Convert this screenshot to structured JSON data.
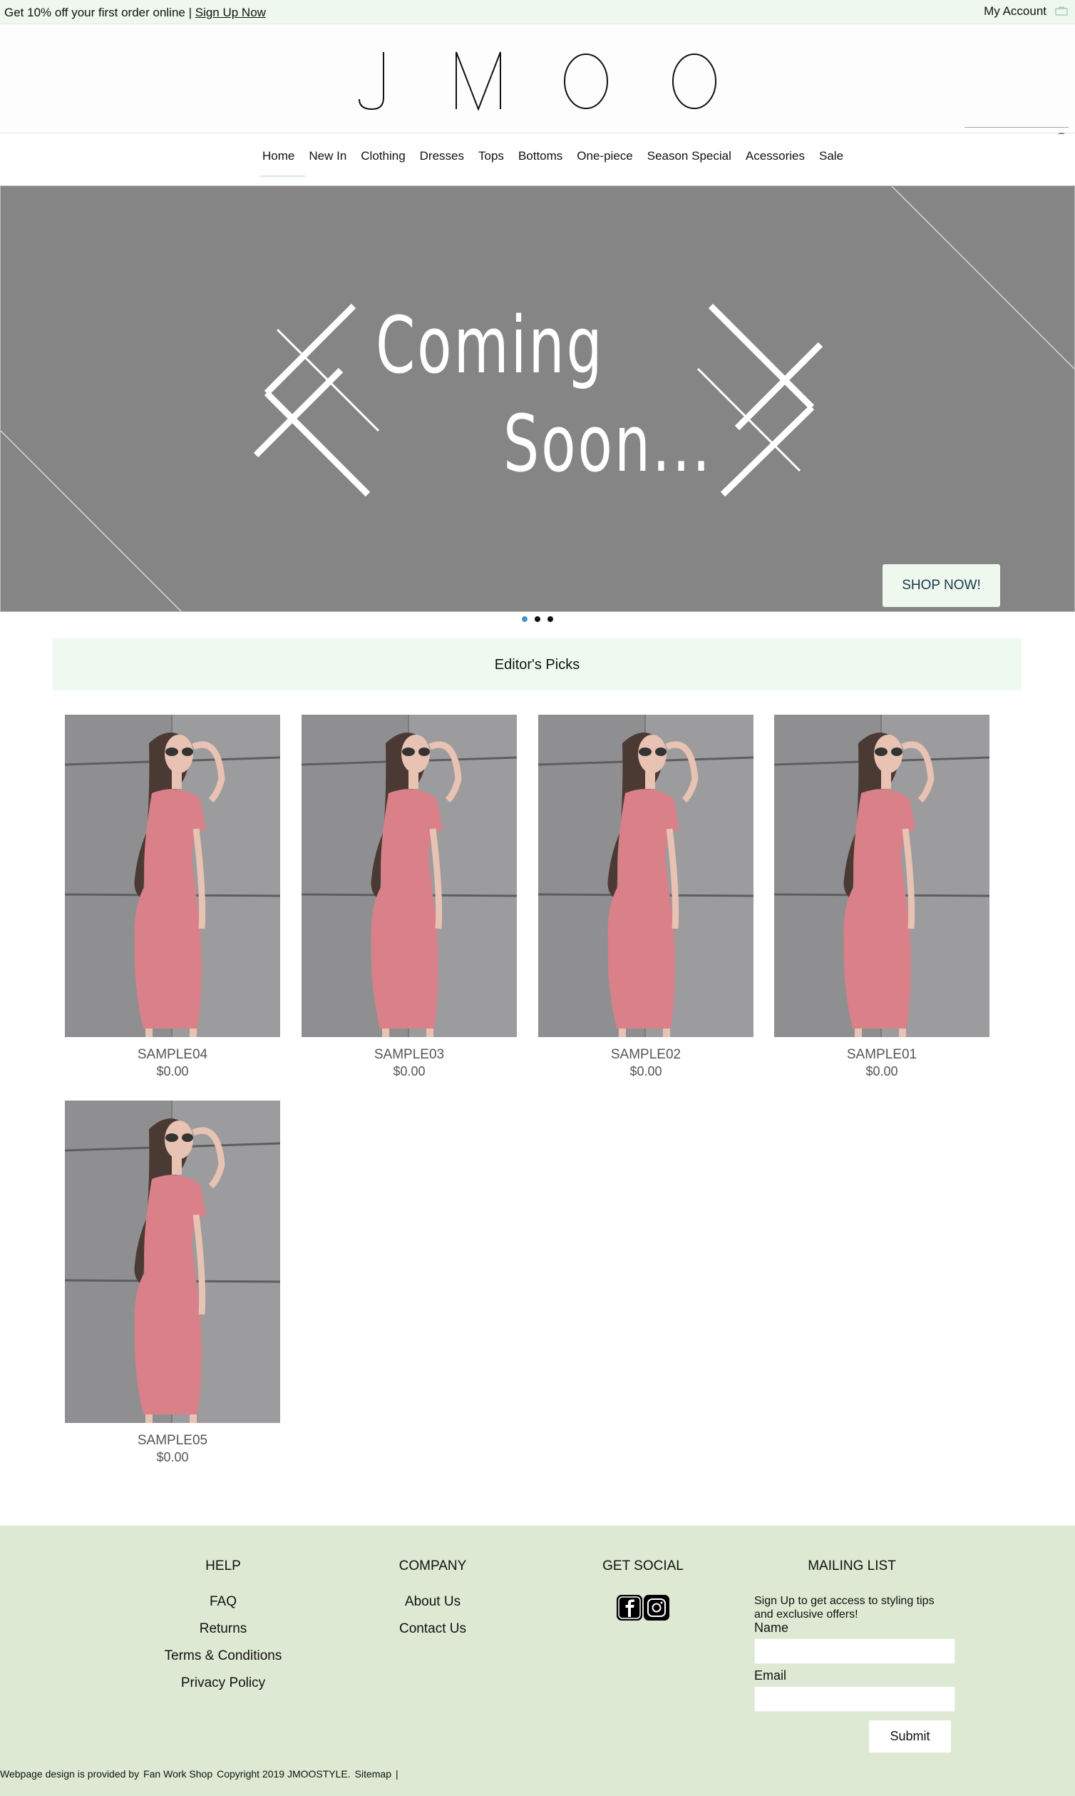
{
  "promo": {
    "text": "Get 10% off your first order online | ",
    "link": "Sign Up Now"
  },
  "header": {
    "account_label": "My Account",
    "logo_letters": [
      "J",
      "M",
      "O",
      "O"
    ],
    "search_placeholder": ""
  },
  "nav": {
    "items": [
      "Home",
      "New In",
      "Clothing",
      "Dresses",
      "Tops",
      "Bottoms",
      "One-piece",
      "Season Special",
      "Acessories",
      "Sale"
    ],
    "active": "Home"
  },
  "hero": {
    "line1": "Coming",
    "line2": "Soon...",
    "button": "SHOP NOW!",
    "slides": 3,
    "active_slide": 1
  },
  "picks": {
    "title": "Editor's Picks"
  },
  "products": [
    {
      "name": "SAMPLE04",
      "price": "$0.00"
    },
    {
      "name": "SAMPLE03",
      "price": "$0.00"
    },
    {
      "name": "SAMPLE02",
      "price": "$0.00"
    },
    {
      "name": "SAMPLE01",
      "price": "$0.00"
    },
    {
      "name": "SAMPLE05",
      "price": "$0.00"
    }
  ],
  "footer": {
    "help": {
      "title": "HELP",
      "links": [
        "FAQ",
        "Returns",
        "Terms & Conditions",
        "Privacy Policy"
      ]
    },
    "company": {
      "title": "COMPANY",
      "links": [
        "About Us",
        "Contact Us"
      ]
    },
    "social": {
      "title": "GET SOCIAL",
      "icons": [
        "facebook-icon",
        "instagram-icon"
      ]
    },
    "mailing": {
      "title": "MAILING LIST",
      "description": "Sign Up to get access to styling tips and exclusive offers!",
      "name_label": "Name",
      "email_label": "Email",
      "submit": "Submit"
    },
    "credits": [
      "Webpage design is provided by",
      "Fan Work Shop",
      "Copyright 2019 JMOOSTYLE.",
      "Sitemap",
      "|"
    ]
  },
  "colors": {
    "promo_bg": "#eef8ef",
    "hero_bg": "#858585",
    "footer_bg": "#dde9d3",
    "dot_active": "#4a90c2",
    "dress": "#d98089"
  }
}
